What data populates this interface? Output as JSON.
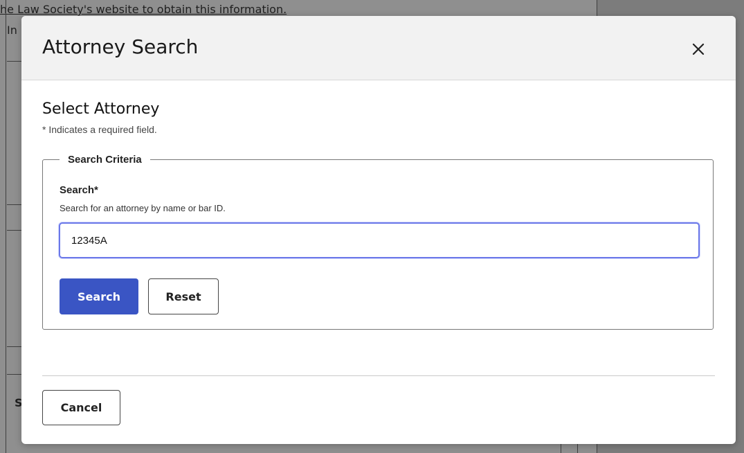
{
  "background": {
    "snippet_top": "he Law Society's website to obtain this information.",
    "snippet_left": "In",
    "snippet_s": "S"
  },
  "modal": {
    "title": "Attorney Search",
    "close_icon": "close-icon",
    "section_title": "Select Attorney",
    "required_note": "* Indicates a required field.",
    "fieldset_legend": "Search Criteria",
    "search_label": "Search*",
    "search_help": "Search for an attorney by name or bar ID.",
    "search_value": "12345A",
    "search_button": "Search",
    "reset_button": "Reset",
    "cancel_button": "Cancel"
  },
  "colors": {
    "primary": "#3a55c4",
    "focus_border": "#6b78e8",
    "header_bg": "#f2f2f2",
    "overlay": "#8f8f8f"
  }
}
